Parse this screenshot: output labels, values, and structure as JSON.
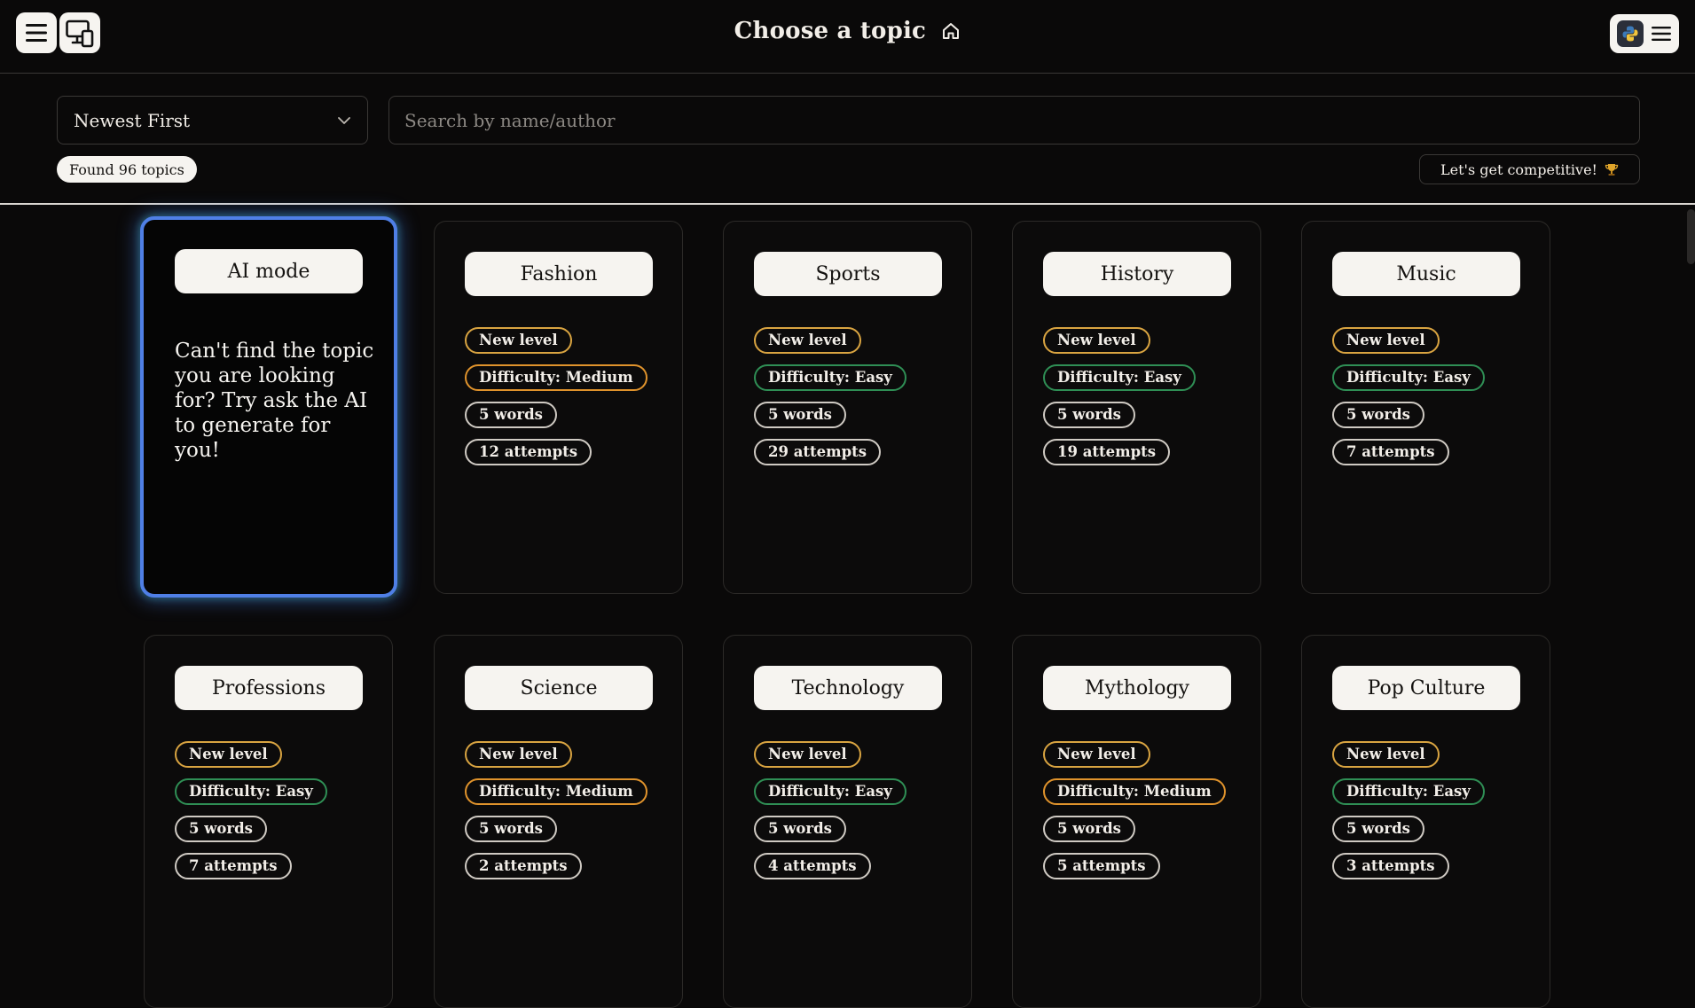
{
  "header": {
    "title": "Choose a topic",
    "menu_icon": "hamburger-menu-icon",
    "device_icon": "monitor-phone-icon",
    "home_icon": "home-icon",
    "profile_icon": "python-logo-avatar-icon"
  },
  "toolbar": {
    "sort_value": "Newest First",
    "search_placeholder": "Search by name/author",
    "found_text": "Found 96 topics",
    "compete_label": "Let's get competitive!",
    "compete_icon": "trophy-icon"
  },
  "ai_card": {
    "title": "AI mode",
    "description": "Can't find the topic you are looking for? Try ask the AI to generate for you!"
  },
  "topics": [
    {
      "title": "Fashion",
      "level": "New level",
      "difficulty": "Difficulty: Medium",
      "words": "5 words",
      "attempts": "12 attempts"
    },
    {
      "title": "Sports",
      "level": "New level",
      "difficulty": "Difficulty: Easy",
      "words": "5 words",
      "attempts": "29 attempts"
    },
    {
      "title": "History",
      "level": "New level",
      "difficulty": "Difficulty: Easy",
      "words": "5 words",
      "attempts": "19 attempts"
    },
    {
      "title": "Music",
      "level": "New level",
      "difficulty": "Difficulty: Easy",
      "words": "5 words",
      "attempts": "7 attempts"
    },
    {
      "title": "Professions",
      "level": "New level",
      "difficulty": "Difficulty: Easy",
      "words": "5 words",
      "attempts": "7 attempts"
    },
    {
      "title": "Science",
      "level": "New level",
      "difficulty": "Difficulty: Medium",
      "words": "5 words",
      "attempts": "2 attempts"
    },
    {
      "title": "Technology",
      "level": "New level",
      "difficulty": "Difficulty: Easy",
      "words": "5 words",
      "attempts": "4 attempts"
    },
    {
      "title": "Mythology",
      "level": "New level",
      "difficulty": "Difficulty: Medium",
      "words": "5 words",
      "attempts": "5 attempts"
    },
    {
      "title": "Pop Culture",
      "level": "New level",
      "difficulty": "Difficulty: Easy",
      "words": "5 words",
      "attempts": "3 attempts"
    }
  ],
  "colors": {
    "background": "#0a0909",
    "new_level_border": "#d9a441",
    "medium_border": "#e0932c",
    "easy_border": "#2f8f55",
    "ai_glow": "#4f7fe6"
  }
}
